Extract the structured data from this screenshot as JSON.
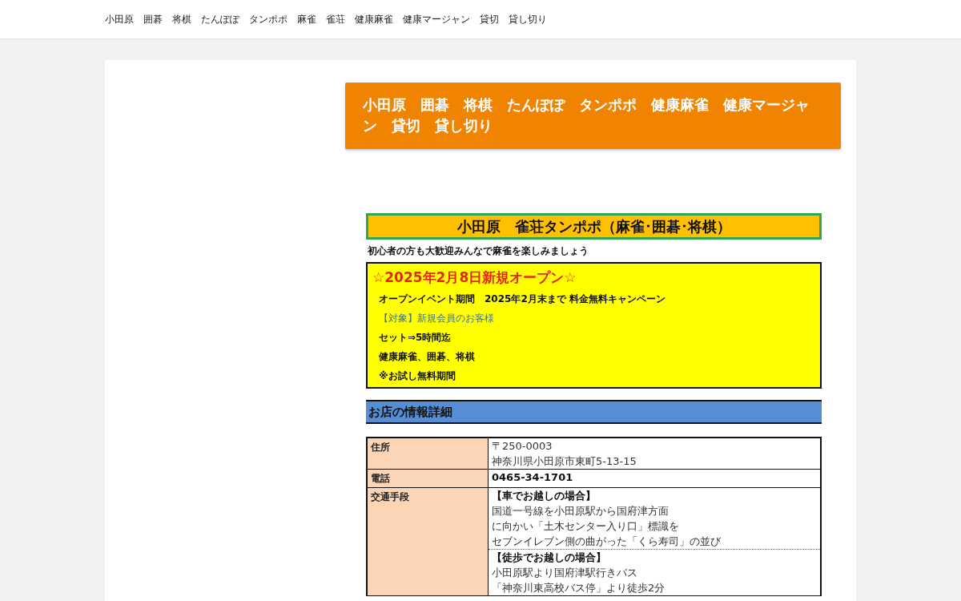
{
  "nav": {
    "items": [
      "小田原",
      "囲碁",
      "将棋",
      "たんぽぽ",
      "タンポポ",
      "麻雀",
      "雀荘",
      "健康麻雀",
      "健康マージャン",
      "貸切",
      "貸し切り"
    ]
  },
  "heading": "小田原　囲碁　将棋　たんぽぽ　タンポポ　健康麻雀　健康マージャン　貸切　貸し切り",
  "flyer": {
    "title": "小田原　雀荘タンポポ（麻雀･囲碁･将棋）",
    "subtitle": "初心者の方も大歓迎みんなで麻雀を楽しみましょう",
    "promo": {
      "headline": "☆2025年2月8日新規オープン☆",
      "lines": [
        {
          "text": "オープンイベント期間　2025年2月末まで 料金無料キャンペーン",
          "kind": "plain"
        },
        {
          "text": "【対象】新規会員のお客様",
          "kind": "highlight"
        },
        {
          "text": "セット⇒5時間迄",
          "kind": "plain"
        },
        {
          "text": "健康麻雀、囲碁、将棋",
          "kind": "plain"
        },
        {
          "text": "※お試し無料期間",
          "kind": "plain"
        }
      ]
    },
    "section_title": "お店の情報詳細",
    "info_rows": [
      {
        "label": "住所",
        "blocks": [
          [
            {
              "text": "〒250-0003",
              "kind": "plain"
            },
            {
              "text": "神奈川県小田原市東町5-13-15",
              "kind": "plain"
            }
          ]
        ]
      },
      {
        "label": "電話",
        "blocks": [
          [
            {
              "text": "0465-34-1701",
              "kind": "strong"
            }
          ]
        ]
      },
      {
        "label": "交通手段",
        "blocks": [
          [
            {
              "text": "【車でお越しの場合】",
              "kind": "strong"
            },
            {
              "text": "国道一号線を小田原駅から国府津方面",
              "kind": "plain"
            },
            {
              "text": "に向かい「土木センター入り口」標識を",
              "kind": "plain"
            },
            {
              "text": "セブンイレブン側の曲がった「くら寿司」の並び",
              "kind": "plain"
            }
          ],
          [
            {
              "text": "【徒歩でお越しの場合】",
              "kind": "strong"
            },
            {
              "text": "小田原駅より国府津駅行きバス",
              "kind": "plain"
            },
            {
              "text": "「神奈川東高校バス停」より徒歩2分",
              "kind": "plain"
            }
          ]
        ]
      }
    ]
  }
}
